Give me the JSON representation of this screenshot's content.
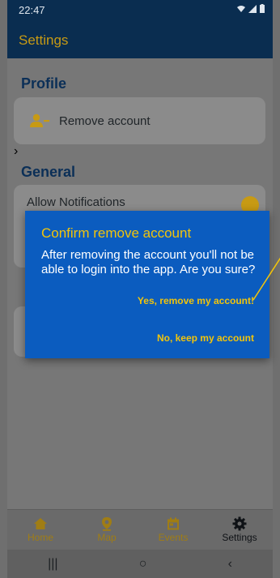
{
  "status_bar": {
    "time": "22:47",
    "wifi_icon": "wifi-icon",
    "signal_icon": "signal-icon",
    "battery_icon": "battery-icon"
  },
  "app_bar": {
    "title": "Settings"
  },
  "profile": {
    "title": "Profile",
    "remove_account": {
      "label": "Remove account",
      "icon": "user-minus-icon",
      "chevron": "›"
    }
  },
  "general": {
    "title": "General",
    "allow_notifications": {
      "label": "Allow Notifications",
      "enabled": true
    }
  },
  "dialog": {
    "title": "Confirm remove account",
    "message": "After removing the account you'll not be able to login into the app. Are you sure?",
    "confirm_label": "Yes, remove my account!",
    "cancel_label": "No, keep my account"
  },
  "bottom_nav": {
    "items": [
      {
        "label": "Home",
        "icon": "home-icon"
      },
      {
        "label": "Map",
        "icon": "map-pin-icon"
      },
      {
        "label": "Events",
        "icon": "calendar-icon"
      },
      {
        "label": "Settings",
        "icon": "gear-icon",
        "active": true
      }
    ]
  },
  "system_nav": {
    "recents": "|||",
    "home": "○",
    "back": "‹"
  },
  "colors": {
    "primary_dark": "#0a2d50",
    "accent_gold": "#c79a14",
    "dialog_blue": "#0b5cbf",
    "dialog_highlight": "#f2c40a"
  }
}
